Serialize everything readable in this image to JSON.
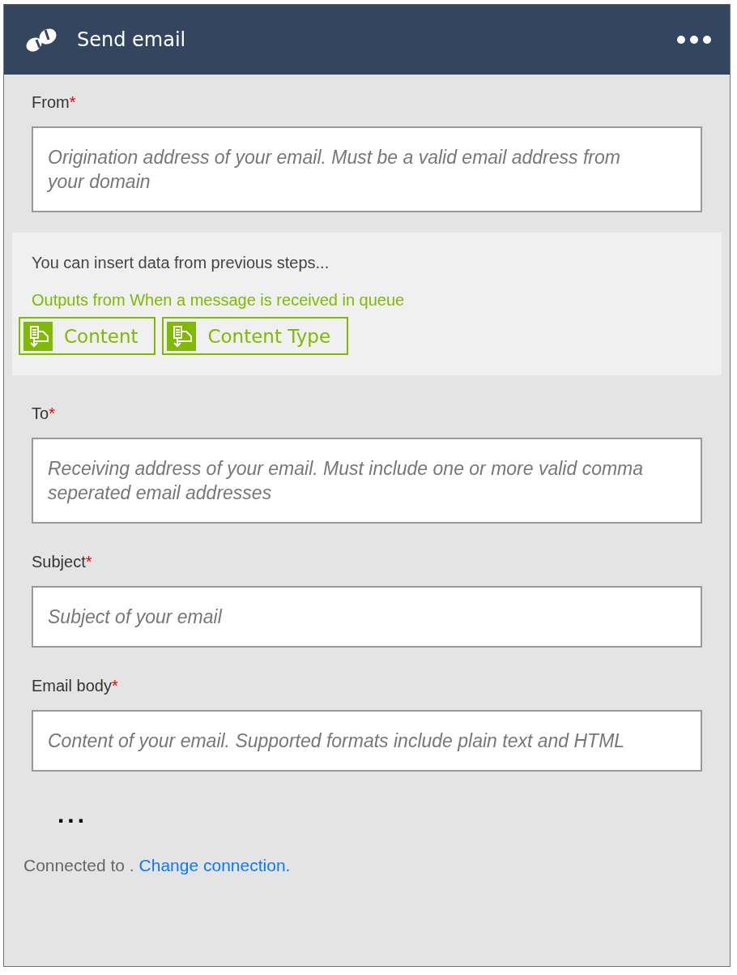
{
  "header": {
    "title": "Send email"
  },
  "fields_top": [
    {
      "label": "From",
      "required_mark": "*",
      "placeholder": "Origination address of your email. Must be a valid email address from your domain"
    }
  ],
  "insert_panel": {
    "hint": "You can insert data from previous steps...",
    "source": "Outputs from When a message is received in queue",
    "tokens": [
      {
        "label": "Content"
      },
      {
        "label": "Content Type"
      }
    ]
  },
  "fields": [
    {
      "label": "To",
      "required_mark": "*",
      "placeholder": "Receiving address of your email. Must include one or more valid comma seperated email addresses"
    },
    {
      "label": "Subject",
      "required_mark": "*",
      "placeholder": "Subject of your email"
    },
    {
      "label": "Email body",
      "required_mark": "*",
      "placeholder": "Content of your email. Supported formats include plain text and HTML"
    }
  ],
  "more": "...",
  "footer": {
    "text": "Connected to .",
    "link": "Change connection."
  }
}
